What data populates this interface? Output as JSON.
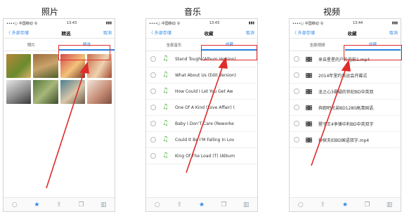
{
  "panels": [
    {
      "title": "照片",
      "status": {
        "left": "••••○ 中国移动 令",
        "time": "13:43",
        "right": "▮▮▮"
      },
      "nav": {
        "back": "〈 外部存储",
        "title": "精选",
        "action": "取消"
      },
      "tabs": [
        "照片",
        "精选"
      ],
      "active_tab": 1
    },
    {
      "title": "音乐",
      "status": {
        "left": "••••○ 中国移动 令",
        "time": "13:43",
        "right": "▮▮▮"
      },
      "nav": {
        "back": "〈 外部存储",
        "title": "收藏",
        "action": "取消"
      },
      "tabs": [
        "全部音乐",
        "收藏"
      ],
      "active_tab": 1,
      "items": [
        "Stand Tough (Album Version)",
        "What About Us (Edit Version)",
        "How Could I Let You Get Aw",
        "One Of A Kind (Love Affair) (",
        "Baby I Don'T Care (Reworke",
        "Could It Be I'M Falling In Lov",
        "King Of The Load (T) (Album"
      ]
    },
    {
      "title": "视频",
      "status": {
        "left": "••••○ 中国移动 令",
        "time": "13:44",
        "right": "▮▮▮"
      },
      "nav": {
        "back": "〈 外部存储",
        "title": "收藏",
        "action": "取消"
      },
      "tabs": [
        "全部视频",
        "收藏"
      ],
      "active_tab": 1,
      "items": [
        "来自星星的户外电影1.mp4",
        "2014年里约奥运会开幕式",
        "龙之心3悬疑的世纪BD中英双",
        "奔跑吧兄弟BD1280高清国语.",
        "猩子王4争锋中利BD中英双字",
        "神探夫妇BD国语双字.mp4"
      ]
    }
  ],
  "toolbar_icons": [
    "circle-icon",
    "star-icon",
    "share-icon",
    "copy-icon",
    "trash-icon"
  ],
  "colors": {
    "accent": "#2f86e8",
    "highlight": "#e02b2b",
    "note": "#5db14f"
  }
}
